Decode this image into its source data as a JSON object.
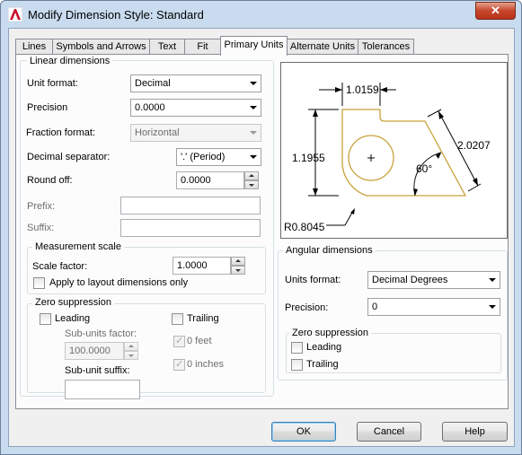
{
  "window": {
    "title": "Modify Dimension Style: Standard",
    "close_glyph": "✕",
    "app_icon": "autocad-icon",
    "accent": "#c9dbee"
  },
  "tabs": [
    {
      "label": "Lines"
    },
    {
      "label": "Symbols and Arrows"
    },
    {
      "label": "Text"
    },
    {
      "label": "Fit"
    },
    {
      "label": "Primary Units",
      "active": true
    },
    {
      "label": "Alternate Units"
    },
    {
      "label": "Tolerances"
    }
  ],
  "linear": {
    "title": "Linear dimensions",
    "unit_format_label": "Unit format:",
    "unit_format_value": "Decimal",
    "precision_label": "Precision",
    "precision_value": "0.0000",
    "fraction_format_label": "Fraction format:",
    "fraction_format_value": "Horizontal",
    "decimal_separator_label": "Decimal separator:",
    "decimal_separator_value": "'.' (Period)",
    "round_off_label": "Round off:",
    "round_off_value": "0.0000",
    "prefix_label": "Prefix:",
    "prefix_value": "",
    "suffix_label": "Suffix:",
    "suffix_value": ""
  },
  "measurement": {
    "title": "Measurement scale",
    "scale_factor_label": "Scale factor:",
    "scale_factor_value": "1.0000",
    "apply_layout_label": "Apply to layout dimensions only",
    "apply_layout_checked": false
  },
  "zero_linear": {
    "title": "Zero suppression",
    "leading_label": "Leading",
    "leading_checked": false,
    "trailing_label": "Trailing",
    "trailing_checked": false,
    "subunits_factor_label": "Sub-units factor:",
    "subunits_factor_value": "100.0000",
    "feet_label": "0 feet",
    "feet_checked": true,
    "inches_label": "0 inches",
    "inches_checked": true,
    "subunit_suffix_label": "Sub-unit suffix:",
    "subunit_suffix_value": ""
  },
  "preview": {
    "dim_top": "1.0159",
    "dim_left": "1.1955",
    "dim_angled": "2.0207",
    "dim_angle": "60°",
    "dim_radius": "R0.8045"
  },
  "angular": {
    "title": "Angular dimensions",
    "units_format_label": "Units format:",
    "units_format_value": "Decimal Degrees",
    "precision_label": "Precision:",
    "precision_value": "0",
    "zero_title": "Zero suppression",
    "leading_label": "Leading",
    "leading_checked": false,
    "trailing_label": "Trailing",
    "trailing_checked": false
  },
  "buttons": {
    "ok": "OK",
    "cancel": "Cancel",
    "help": "Help"
  }
}
